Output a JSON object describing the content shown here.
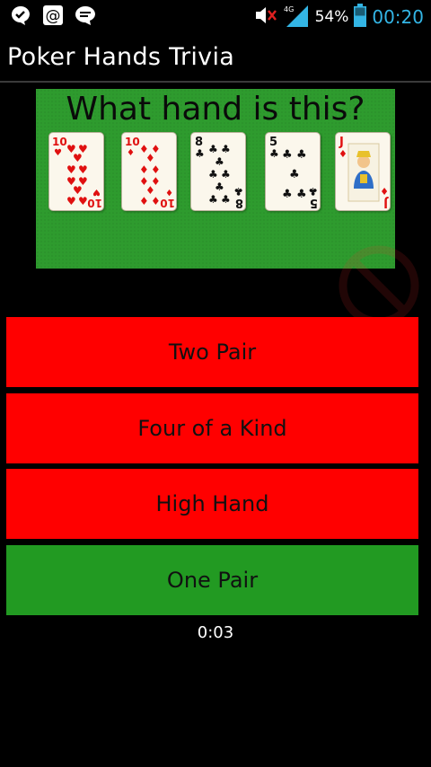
{
  "status_bar": {
    "notification_icons": [
      "check-chat-icon",
      "at-sign-icon",
      "chat-bubble-icon"
    ],
    "network_label": "4G",
    "battery_percent": "54%",
    "time": "00:20",
    "time_color": "#33b5e5"
  },
  "app": {
    "title": "Poker Hands Trivia"
  },
  "question": {
    "prompt": "What hand is this?",
    "background_color": "#2e9b2e",
    "cards": [
      {
        "rank": "10",
        "suit": "hearts",
        "symbol": "♥",
        "color": "#e01010"
      },
      {
        "rank": "10",
        "suit": "diamonds",
        "symbol": "♦",
        "color": "#e01010"
      },
      {
        "rank": "8",
        "suit": "clubs",
        "symbol": "♣",
        "color": "#111111"
      },
      {
        "rank": "5",
        "suit": "clubs",
        "symbol": "♣",
        "color": "#111111"
      },
      {
        "rank": "J",
        "suit": "diamonds",
        "symbol": "♦",
        "color": "#e01010"
      }
    ]
  },
  "answers": [
    {
      "label": "Two Pair",
      "state": "wrong",
      "color": "#ff0000"
    },
    {
      "label": "Four of a Kind",
      "state": "wrong",
      "color": "#ff0000"
    },
    {
      "label": "High Hand",
      "state": "wrong",
      "color": "#ff0000"
    },
    {
      "label": "One Pair",
      "state": "correct",
      "color": "#229a22"
    }
  ],
  "timer": "0:03"
}
